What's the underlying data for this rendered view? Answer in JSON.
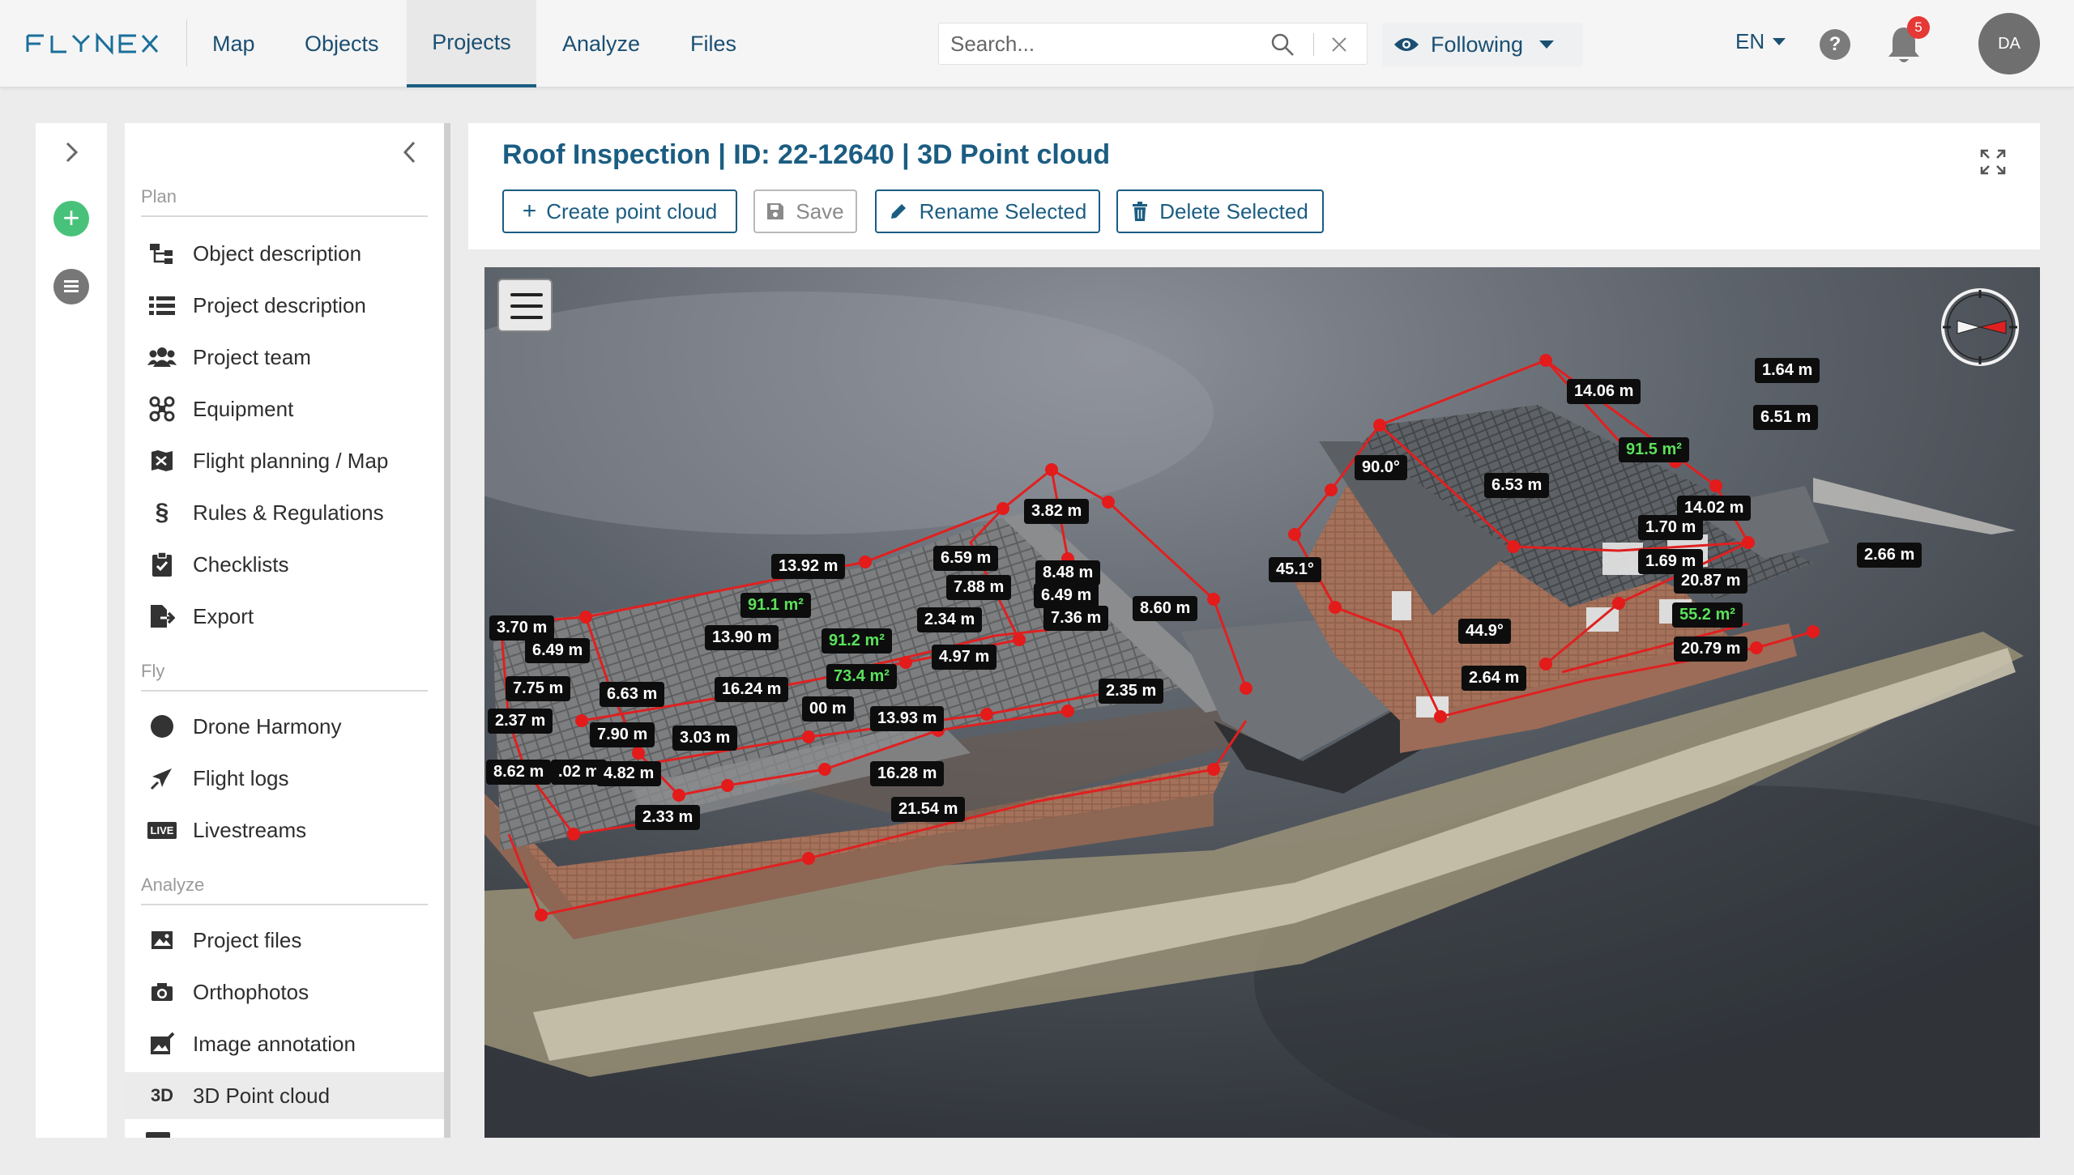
{
  "app": {
    "logo": "FLYNEX"
  },
  "nav": [
    {
      "label": "Map"
    },
    {
      "label": "Objects"
    },
    {
      "label": "Projects"
    },
    {
      "label": "Analyze"
    },
    {
      "label": "Files"
    }
  ],
  "search": {
    "placeholder": "Search..."
  },
  "following": {
    "label": "Following"
  },
  "lang": {
    "label": "EN"
  },
  "help": {
    "label": "?"
  },
  "notifications": {
    "count": "5"
  },
  "user": {
    "initials": "DA"
  },
  "sidebar": {
    "sections": [
      {
        "label": "Plan"
      },
      {
        "label": "Fly"
      },
      {
        "label": "Analyze"
      }
    ],
    "items": [
      {
        "label": "Object description",
        "icon": "object-tree-icon"
      },
      {
        "label": "Project description",
        "icon": "list-icon"
      },
      {
        "label": "Project team",
        "icon": "team-icon"
      },
      {
        "label": "Equipment",
        "icon": "drone-icon"
      },
      {
        "label": "Flight planning / Map",
        "icon": "map-icon"
      },
      {
        "label": "Rules & Regulations",
        "icon": "section-sign-icon",
        "glyph": "§"
      },
      {
        "label": "Checklists",
        "icon": "clipboard-check-icon"
      },
      {
        "label": "Export",
        "icon": "export-icon"
      },
      {
        "label": "Drone Harmony",
        "icon": "circle-icon"
      },
      {
        "label": "Flight logs",
        "icon": "plane-icon"
      },
      {
        "label": "Livestreams",
        "icon": "live-icon",
        "glyph": "LIVE"
      },
      {
        "label": "Project files",
        "icon": "folder-image-icon"
      },
      {
        "label": "Orthophotos",
        "icon": "camera-icon"
      },
      {
        "label": "Image annotation",
        "icon": "annotate-icon"
      },
      {
        "label": "3D Point cloud",
        "icon": "3d-icon",
        "glyph": "3D"
      }
    ]
  },
  "page": {
    "title": "Roof Inspection | ID: 22-12640 | 3D Point cloud"
  },
  "toolbar": {
    "create_label": "Create point cloud",
    "save_label": "Save",
    "rename_label": "Rename Selected",
    "delete_label": "Delete Selected"
  },
  "viewer": {
    "labels": [
      {
        "text": "3.70 m",
        "kind": "length"
      },
      {
        "text": "6.49 m",
        "kind": "length"
      },
      {
        "text": "7.75 m",
        "kind": "length"
      },
      {
        "text": "2.37 m",
        "kind": "length"
      },
      {
        "text": "8.62 m",
        "kind": "length"
      },
      {
        "text": ".02 m",
        "kind": "length"
      },
      {
        "text": "4.82 m",
        "kind": "length"
      },
      {
        "text": "7.90 m",
        "kind": "length"
      },
      {
        "text": "6.63 m",
        "kind": "length"
      },
      {
        "text": "3.03 m",
        "kind": "length"
      },
      {
        "text": "2.33 m",
        "kind": "length"
      },
      {
        "text": "13.92 m",
        "kind": "length"
      },
      {
        "text": "91.1 m²",
        "kind": "area"
      },
      {
        "text": "13.90 m",
        "kind": "length"
      },
      {
        "text": "16.24 m",
        "kind": "length"
      },
      {
        "text": "00 m",
        "kind": "length"
      },
      {
        "text": "73.4 m²",
        "kind": "area"
      },
      {
        "text": "91.2 m²",
        "kind": "area"
      },
      {
        "text": "13.93 m",
        "kind": "length"
      },
      {
        "text": "16.28 m",
        "kind": "length"
      },
      {
        "text": "21.54 m",
        "kind": "length"
      },
      {
        "text": "6.59 m",
        "kind": "length"
      },
      {
        "text": "7.88 m",
        "kind": "length"
      },
      {
        "text": "2.34 m",
        "kind": "length"
      },
      {
        "text": "4.97 m",
        "kind": "length"
      },
      {
        "text": "3.82 m",
        "kind": "length"
      },
      {
        "text": "8.48 m",
        "kind": "length"
      },
      {
        "text": "6.49 m",
        "kind": "length"
      },
      {
        "text": "7.36 m",
        "kind": "length"
      },
      {
        "text": "8.60 m",
        "kind": "length"
      },
      {
        "text": "2.35 m",
        "kind": "length"
      },
      {
        "text": "45.1°",
        "kind": "angle"
      },
      {
        "text": "90.0°",
        "kind": "angle"
      },
      {
        "text": "6.53 m",
        "kind": "length"
      },
      {
        "text": "14.06 m",
        "kind": "length"
      },
      {
        "text": "91.5 m²",
        "kind": "area"
      },
      {
        "text": "1.64 m",
        "kind": "length"
      },
      {
        "text": "6.51 m",
        "kind": "length"
      },
      {
        "text": "14.02 m",
        "kind": "length"
      },
      {
        "text": "1.70 m",
        "kind": "length"
      },
      {
        "text": "1.69 m",
        "kind": "length"
      },
      {
        "text": "20.87 m",
        "kind": "length"
      },
      {
        "text": "55.2 m²",
        "kind": "area"
      },
      {
        "text": "20.79 m",
        "kind": "length"
      },
      {
        "text": "2.66 m",
        "kind": "length"
      },
      {
        "text": "44.9°",
        "kind": "angle"
      },
      {
        "text": "2.64 m",
        "kind": "length"
      }
    ]
  },
  "colors": {
    "brand": "#1b5d82",
    "measure_line": "#e02020",
    "area_text": "#5be15b",
    "add_button": "#48c27a",
    "badge": "#e53935"
  }
}
